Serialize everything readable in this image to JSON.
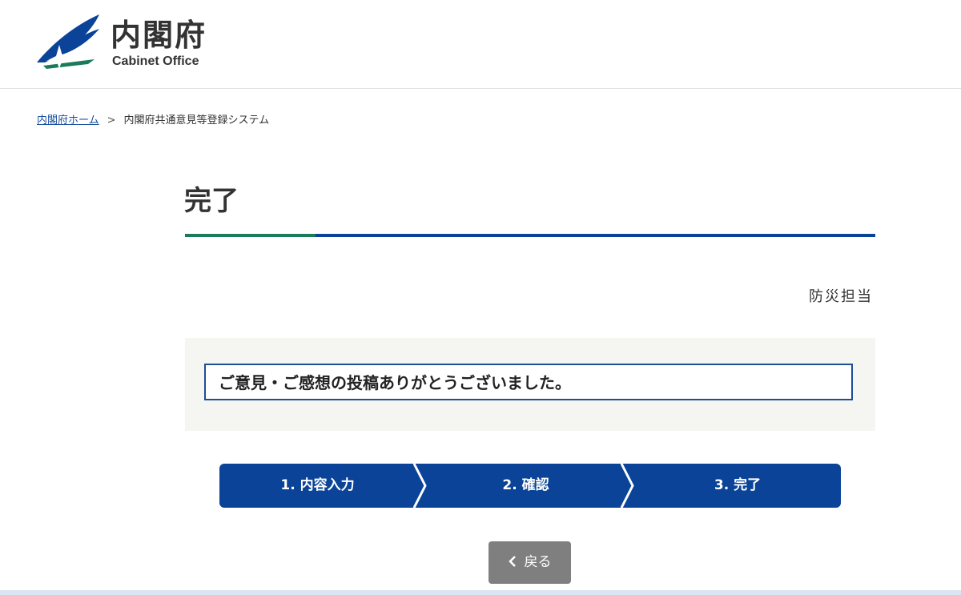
{
  "header": {
    "logo_ja": "内閣府",
    "logo_en": "Cabinet Office"
  },
  "breadcrumb": {
    "home_label": "内閣府ホーム",
    "separator": ">",
    "current": "内閣府共通意見等登録システム"
  },
  "page": {
    "title": "完了",
    "department": "防災担当",
    "message": "ご意見・ご感想の投稿ありがとうございました。"
  },
  "steps": [
    {
      "label": "1. 内容入力"
    },
    {
      "label": "2. 確認"
    },
    {
      "label": "3. 完了"
    }
  ],
  "back_button": {
    "label": "戻る",
    "icon": "chevron-left-icon"
  },
  "colors": {
    "brand_blue": "#0a4397",
    "brand_green": "#1b7a57",
    "panel_bg": "#f5f5f2",
    "back_button": "#7f7f7f"
  }
}
